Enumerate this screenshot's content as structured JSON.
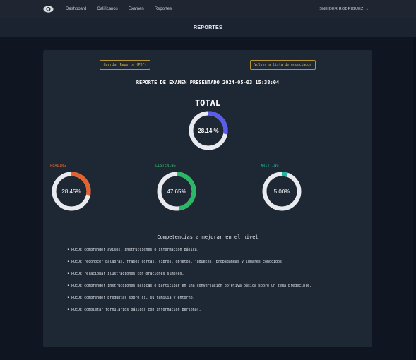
{
  "nav": {
    "links": [
      "Dashboard",
      "Calificanos",
      "Examen",
      "Reportes"
    ],
    "user": "SNEIDER RODRIGUEZ"
  },
  "page_title": "REPORTES",
  "actions": {
    "save": "Guardar Reporte (PDF)",
    "back": "Volver a lista de enunciados"
  },
  "report_title": "REPORTE DE EXAMEN PRESENTADO 2024-05-03 15:38:04",
  "total": {
    "label": "TOTAL",
    "value_text": "28.14 %",
    "percent": 28.14,
    "color": "#5b5de8"
  },
  "skills": [
    {
      "label": "READING",
      "value_text": "28.45%",
      "percent": 28.45,
      "color": "#e4622b",
      "label_color": "#d9622e"
    },
    {
      "label": "LISTENING",
      "value_text": "47.65%",
      "percent": 47.65,
      "color": "#2bb865",
      "label_color": "#37b86a"
    },
    {
      "label": "WRITTING",
      "value_text": "5.00%",
      "percent": 5.0,
      "color": "#1fb5a2",
      "label_color": "#2ab6a6"
    }
  ],
  "competencias": {
    "title": "Competencias a mejorar en el nivel",
    "items": [
      "PUEDE comprender avisos, instrucciones o información básica.",
      "PUEDE reconocer palabras, frases cortas, libros, objetos, juguetes, propagandas y lugares conocidos.",
      "PUEDE relacionar ilustraciones con oraciones simples.",
      "PUEDE comprender instrucciones básicas o participar en una conversación objetiva básica sobre un tema predecible.",
      "PUEDE comprender preguntas sobre sí, su familia y entorno.",
      "PUEDE completar formularios básicos con información personal."
    ]
  },
  "colors": {
    "track": "#e8eaee",
    "background": "#0f1621",
    "card": "#1e2734",
    "accent_button": "#d9b84a"
  }
}
